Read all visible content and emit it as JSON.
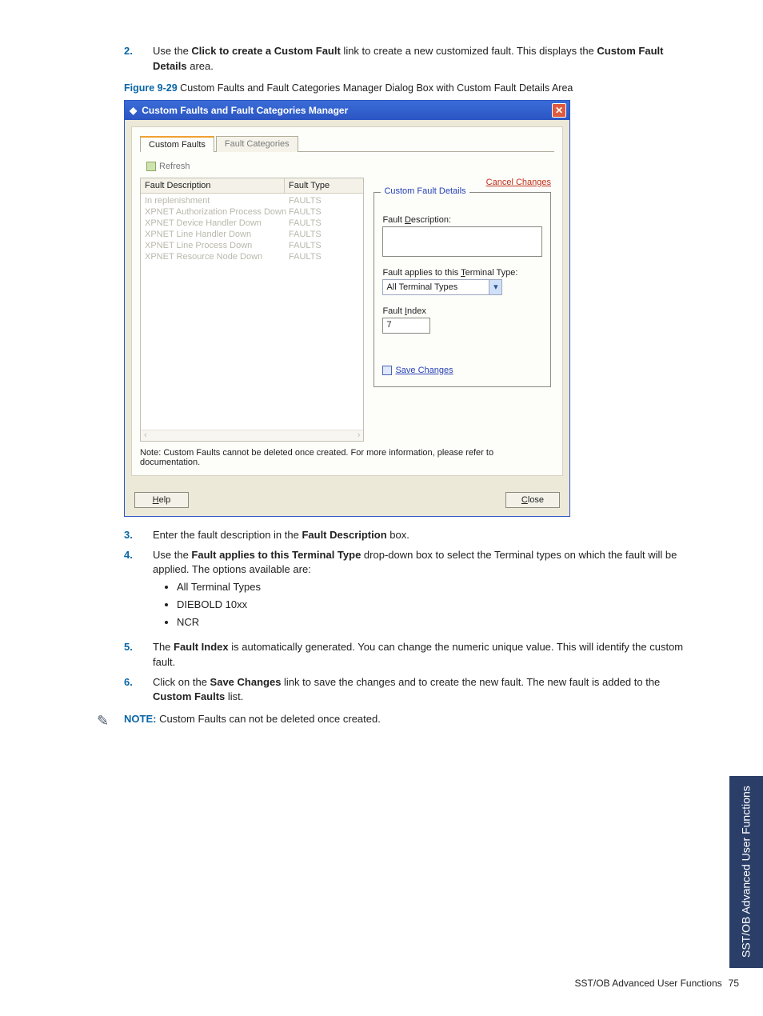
{
  "step2": {
    "prefix": "Use the ",
    "link": "Click to create a Custom Fault",
    "mid": " link to create a new customized fault.  This displays the ",
    "bold2": "Custom Fault Details",
    "tail": " area."
  },
  "figure": {
    "num": "Figure 9-29",
    "caption": " Custom Faults and Fault Categories Manager Dialog Box with Custom Fault Details Area"
  },
  "dialog": {
    "title": "Custom Faults and Fault Categories Manager",
    "close_x": "✕",
    "tabs": {
      "t1": "Custom Faults",
      "t2": "Fault Categories"
    },
    "refresh": "Refresh",
    "headers": {
      "desc": "Fault Description",
      "type": "Fault Type"
    },
    "rows": [
      {
        "d": "In replenishment",
        "t": "FAULTS"
      },
      {
        "d": "XPNET Authorization Process Down",
        "t": "FAULTS"
      },
      {
        "d": "XPNET Device Handler Down",
        "t": "FAULTS"
      },
      {
        "d": "XPNET Line Handler Down",
        "t": "FAULTS"
      },
      {
        "d": "XPNET Line Process Down",
        "t": "FAULTS"
      },
      {
        "d": "XPNET Resource Node Down",
        "t": "FAULTS"
      }
    ],
    "cancel": "Cancel Changes",
    "group_legend": "Custom Fault Details",
    "lbl_desc_pre": "Fault ",
    "lbl_desc_ul": "D",
    "lbl_desc_post": "escription:",
    "lbl_term_pre": "Fault applies to this ",
    "lbl_term_ul": "T",
    "lbl_term_post": "erminal Type:",
    "combo_value": "All Terminal Types",
    "lbl_index_pre": "Fault ",
    "lbl_index_ul": "I",
    "lbl_index_post": "ndex",
    "index_value": "7",
    "save": "Save Changes",
    "note": "Note: Custom Faults cannot be deleted once created. For more information, please refer to documentation.",
    "help_pre": "",
    "help_ul": "H",
    "help_post": "elp",
    "close_pre": "",
    "close_ul": "C",
    "close_post": "lose"
  },
  "step3": {
    "pre": "Enter the fault description in the ",
    "b": "Fault Description",
    "post": " box."
  },
  "step4": {
    "pre": "Use the ",
    "b": "Fault applies to this Terminal Type",
    "post": " drop-down box to select the Terminal types on which the fault will be applied.  The options available are:"
  },
  "bullets": [
    "All Terminal Types",
    "DIEBOLD 10xx",
    "NCR"
  ],
  "step5": {
    "pre": "The ",
    "b": "Fault Index",
    "post": " is automatically generated.  You can change the numeric unique value.  This will identify the custom fault."
  },
  "step6": {
    "pre": "Click on the ",
    "b": "Save Changes",
    "mid": " link to save the changes and to create the new fault.  The new fault is added to the ",
    "b2": "Custom Faults",
    "post": " list."
  },
  "note": {
    "label": "NOTE:",
    "text": "  Custom Faults can not be deleted once created."
  },
  "footer": {
    "text": "SST/OB Advanced User Functions",
    "page": "75"
  },
  "sidetab": "SST/OB Advanced User\nFunctions",
  "nums": {
    "n2": "2.",
    "n3": "3.",
    "n4": "4.",
    "n5": "5.",
    "n6": "6."
  }
}
